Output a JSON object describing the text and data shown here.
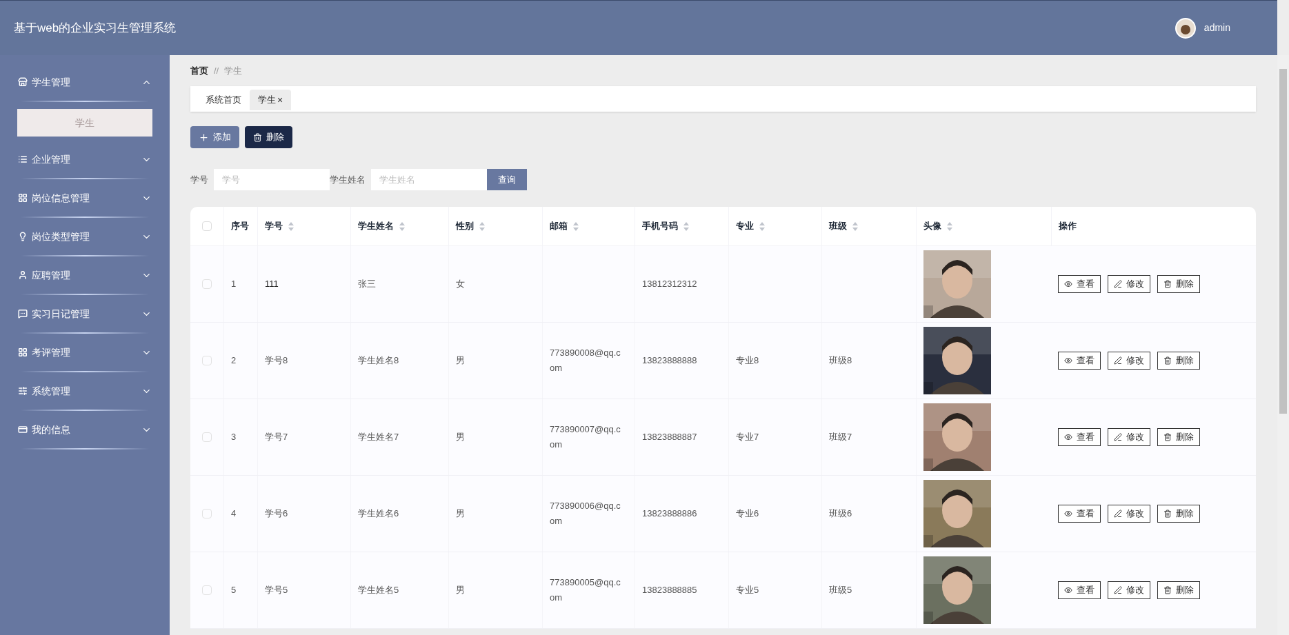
{
  "header": {
    "title": "基于web的企业实习生管理系统",
    "user": "admin"
  },
  "sidebar": {
    "items": [
      {
        "label": "学生管理",
        "expanded": true,
        "children": [
          {
            "label": "学生",
            "selected": true
          }
        ]
      },
      {
        "label": "企业管理",
        "expanded": false
      },
      {
        "label": "岗位信息管理",
        "expanded": false
      },
      {
        "label": "岗位类型管理",
        "expanded": false
      },
      {
        "label": "应聘管理",
        "expanded": false
      },
      {
        "label": "实习日记管理",
        "expanded": false
      },
      {
        "label": "考评管理",
        "expanded": false
      },
      {
        "label": "系统管理",
        "expanded": false
      },
      {
        "label": "我的信息",
        "expanded": false
      }
    ]
  },
  "breadcrumb": [
    "首页",
    "//",
    "学生"
  ],
  "tabs": [
    {
      "label": "系统首页",
      "selected": false
    },
    {
      "label": "学生",
      "selected": true,
      "close": "×"
    }
  ],
  "actions": [
    {
      "label": "添加",
      "kind": "add"
    },
    {
      "label": "删除",
      "kind": "delete"
    }
  ],
  "search": {
    "fields": [
      {
        "label": "学号",
        "placeholder": "学号"
      },
      {
        "label": "学生姓名",
        "placeholder": "学生姓名"
      }
    ],
    "button": "查询"
  },
  "table": {
    "all_checked": false,
    "columns": [
      {
        "label": "序号",
        "sortable": false
      },
      {
        "label": "学号",
        "sortable": true
      },
      {
        "label": "学生姓名",
        "sortable": true
      },
      {
        "label": "性别",
        "sortable": true
      },
      {
        "label": "邮箱",
        "sortable": true
      },
      {
        "label": "手机号码",
        "sortable": true
      },
      {
        "label": "专业",
        "sortable": true
      },
      {
        "label": "班级",
        "sortable": true
      },
      {
        "label": "头像",
        "sortable": true
      },
      {
        "label": "操作",
        "sortable": false
      }
    ],
    "rows": [
      {
        "checked": false,
        "cells": [
          "1",
          "111",
          "张三",
          "女",
          "",
          "13812312312",
          "",
          ""
        ],
        "bold": true,
        "photo": {
          "kind": "picture"
        },
        "actions": [
          "查看",
          "修改",
          "删除"
        ]
      },
      {
        "checked": false,
        "cells": [
          "2",
          "学号8",
          "学生姓名8",
          "男",
          "773890008@qq.com",
          "13823888888",
          "专业8",
          "班级8"
        ],
        "bold": false,
        "photo": {
          "kind": "picture"
        },
        "actions": [
          "查看",
          "修改",
          "删除"
        ]
      },
      {
        "checked": false,
        "cells": [
          "3",
          "学号7",
          "学生姓名7",
          "男",
          "773890007@qq.com",
          "13823888887",
          "专业7",
          "班级7"
        ],
        "bold": false,
        "photo": {
          "kind": "picture"
        },
        "actions": [
          "查看",
          "修改",
          "删除"
        ]
      },
      {
        "checked": false,
        "cells": [
          "4",
          "学号6",
          "学生姓名6",
          "男",
          "773890006@qq.com",
          "13823888886",
          "专业6",
          "班级6"
        ],
        "bold": false,
        "photo": {
          "kind": "picture"
        },
        "actions": [
          "查看",
          "修改",
          "删除"
        ]
      },
      {
        "checked": false,
        "cells": [
          "5",
          "学号5",
          "学生姓名5",
          "男",
          "773890005@qq.com",
          "13823888885",
          "专业5",
          "班级5"
        ],
        "bold": false,
        "photo": {
          "kind": "picture"
        },
        "actions": [
          "查看",
          "修改",
          "删除"
        ]
      }
    ]
  }
}
